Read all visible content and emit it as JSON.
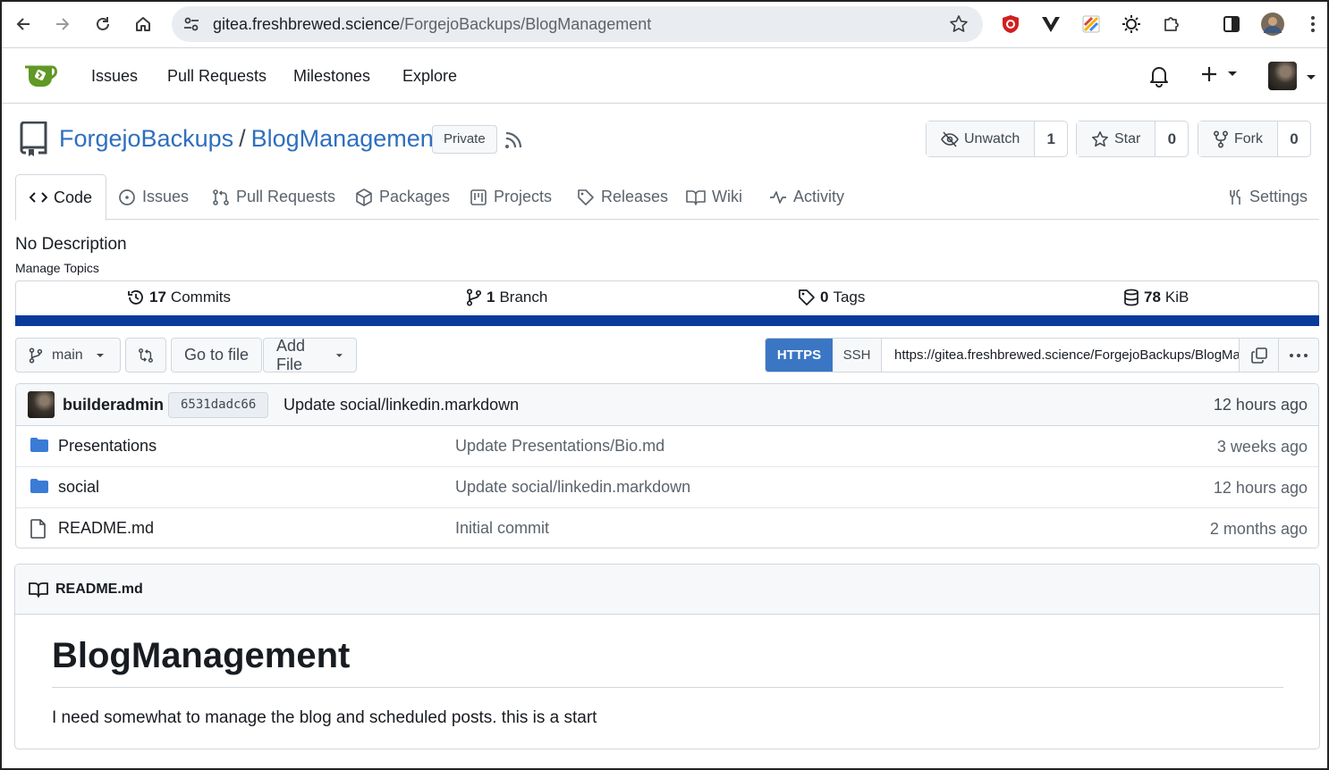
{
  "browser": {
    "url_host": "gitea.freshbrewed.science",
    "url_path": "/ForgejoBackups/BlogManagement"
  },
  "topnav": {
    "items": [
      "Issues",
      "Pull Requests",
      "Milestones",
      "Explore"
    ]
  },
  "repo": {
    "owner": "ForgejoBackups",
    "separator": "/",
    "name": "BlogManagement",
    "visibility": "Private",
    "unwatch_label": "Unwatch",
    "watch_count": "1",
    "star_label": "Star",
    "star_count": "0",
    "fork_label": "Fork",
    "fork_count": "0"
  },
  "tabs": {
    "code": "Code",
    "issues": "Issues",
    "pulls": "Pull Requests",
    "packages": "Packages",
    "projects": "Projects",
    "releases": "Releases",
    "wiki": "Wiki",
    "activity": "Activity",
    "settings": "Settings"
  },
  "description": "No Description",
  "manage_topics": "Manage Topics",
  "stats": {
    "commits_num": "17",
    "commits_label": "Commits",
    "branches_num": "1",
    "branches_label": "Branch",
    "tags_num": "0",
    "tags_label": "Tags",
    "size_num": "78",
    "size_label": "KiB"
  },
  "toolbar": {
    "branch": "main",
    "go_to_file": "Go to file",
    "add_file": "Add File",
    "https": "HTTPS",
    "ssh": "SSH",
    "clone_url": "https://gitea.freshbrewed.science/ForgejoBackups/BlogManagement.git"
  },
  "last_commit": {
    "author": "builderadmin",
    "sha": "6531dadc66",
    "message": "Update social/linkedin.markdown",
    "age": "12 hours ago"
  },
  "files": [
    {
      "name": "Presentations",
      "type": "folder",
      "message": "Update Presentations/Bio.md",
      "age": "3 weeks ago"
    },
    {
      "name": "social",
      "type": "folder",
      "message": "Update social/linkedin.markdown",
      "age": "12 hours ago"
    },
    {
      "name": "README.md",
      "type": "file",
      "message": "Initial commit",
      "age": "2 months ago"
    }
  ],
  "readme": {
    "filename": "README.md",
    "heading": "BlogManagement",
    "body": "I need somewhat to manage the blog and scheduled posts. this is a start"
  },
  "colors": {
    "link": "#2e6fbe",
    "https_active": "#3b76c4",
    "language_bar": "#0a3a9c",
    "folder": "#3a7bd5",
    "logo_green": "#609926"
  }
}
